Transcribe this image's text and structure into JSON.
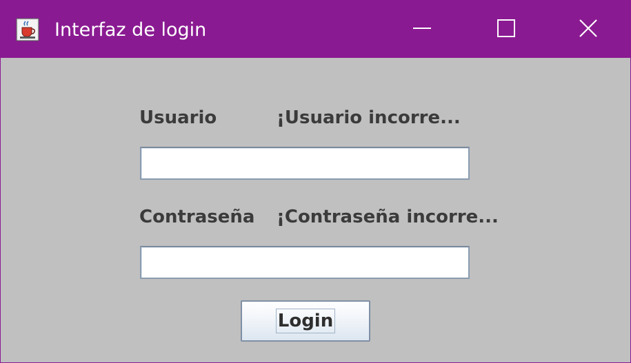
{
  "window": {
    "title": "Interfaz de login",
    "app_icon": "java-coffee-cup-icon",
    "controls": {
      "minimize_icon": "minimize-icon",
      "maximize_icon": "maximize-icon",
      "close_icon": "close-icon"
    },
    "titlebar_color": "#8a1a92",
    "background_color": "#c0c0c0"
  },
  "form": {
    "username_label": "Usuario",
    "username_error": "¡Usuario incorre...",
    "username_value": "",
    "password_label": "Contraseña",
    "password_error": "¡Contraseña incorre...",
    "password_value": "",
    "login_label": "Login"
  }
}
